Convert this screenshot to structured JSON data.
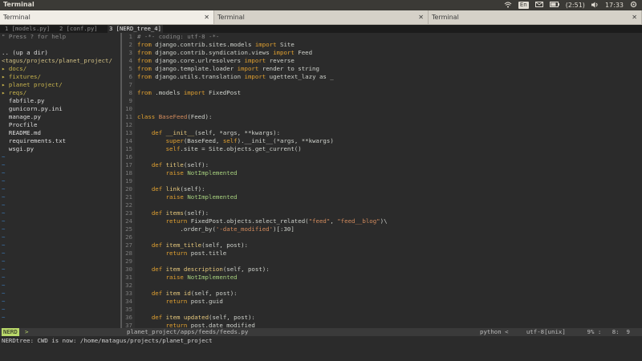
{
  "system": {
    "app_title": "Terminal",
    "battery": "(2:51)",
    "keyboard": "En",
    "clock": "17:33"
  },
  "window_tabs": [
    {
      "label": "Terminal",
      "close": "✕"
    },
    {
      "label": "Terminal",
      "close": "✕"
    },
    {
      "label": "Terminal",
      "close": "✕"
    }
  ],
  "vim_tabs": [
    {
      "label": "1 [models.py]"
    },
    {
      "label": "2 [conf.py]"
    },
    {
      "label": "3 [NERD_tree_4]"
    }
  ],
  "nerdtree": {
    "help": "\" Press ? for help",
    "blank": "",
    "up": ".. (up a dir)",
    "root": "<tagus/projects/planet_project/",
    "entries": [
      {
        "text": "▸ docs/",
        "type": "dir"
      },
      {
        "text": "▸ fixtures/",
        "type": "dir"
      },
      {
        "text": "▸ planet project/",
        "type": "dir"
      },
      {
        "text": "▸ reqs/",
        "type": "dir"
      },
      {
        "text": "  fabfile.py",
        "type": "file"
      },
      {
        "text": "  gunicorn.py.ini",
        "type": "file"
      },
      {
        "text": "  manage.py",
        "type": "file"
      },
      {
        "text": "  Procfile",
        "type": "file"
      },
      {
        "text": "  README.md",
        "type": "file"
      },
      {
        "text": "  requirements.txt",
        "type": "file"
      },
      {
        "text": "  wsgi.py",
        "type": "file"
      }
    ],
    "tilde": "~"
  },
  "code_lines": [
    {
      "n": "1",
      "html": "<span class='cmt'># -*- coding: utf-8 -*-</span>"
    },
    {
      "n": "2",
      "html": "<span class='kw'>from</span> django.contrib.sites.models <span class='kw'>import</span> Site"
    },
    {
      "n": "3",
      "html": "<span class='kw'>from</span> django.contrib.syndication.views <span class='kw'>import</span> Feed"
    },
    {
      "n": "4",
      "html": "<span class='kw'>from</span> django.core.urlresolvers <span class='kw'>import</span> reverse"
    },
    {
      "n": "5",
      "html": "<span class='kw'>from</span> django.template.loader <span class='kw'>import</span> render to string"
    },
    {
      "n": "6",
      "html": "<span class='kw'>from</span> django.utils.translation <span class='kw'>import</span> ugettext_lazy as _"
    },
    {
      "n": "7",
      "html": ""
    },
    {
      "n": "8",
      "html": "<span class='kw'>from</span> .models <span class='kw'>import</span> FixedPost"
    },
    {
      "n": "9",
      "html": ""
    },
    {
      "n": "10",
      "html": ""
    },
    {
      "n": "11",
      "html": "<span class='kw'>class</span> <span class='cls'>BaseFeed</span>(Feed):"
    },
    {
      "n": "12",
      "html": ""
    },
    {
      "n": "13",
      "html": "    <span class='kw'>def</span> <span class='fn'>__init__</span>(self, *args, **kwargs):"
    },
    {
      "n": "14",
      "html": "        <span class='self'>super</span>(BaseFeed, <span class='self'>self</span>).__init__(*args, **kwargs)"
    },
    {
      "n": "15",
      "html": "        <span class='self'>self</span>.site = Site.objects.get_current()"
    },
    {
      "n": "16",
      "html": ""
    },
    {
      "n": "17",
      "html": "    <span class='kw'>def</span> <span class='fn'>title</span>(self):"
    },
    {
      "n": "18",
      "html": "        <span class='kw'>raise</span> <span class='err'>NotImplemented</span>"
    },
    {
      "n": "19",
      "html": ""
    },
    {
      "n": "20",
      "html": "    <span class='kw'>def</span> <span class='fn'>link</span>(self):"
    },
    {
      "n": "21",
      "html": "        <span class='kw'>raise</span> <span class='err'>NotImplemented</span>"
    },
    {
      "n": "22",
      "html": ""
    },
    {
      "n": "23",
      "html": "    <span class='kw'>def</span> <span class='fn'>items</span>(self):"
    },
    {
      "n": "24",
      "html": "        <span class='kw'>return</span> FixedPost.objects.select_related(<span class='str'>\"feed\"</span>, <span class='str'>\"feed__blog\"</span>)\\"
    },
    {
      "n": "25",
      "html": "            .order_by(<span class='str'>'-date_modified'</span>)[:30]"
    },
    {
      "n": "26",
      "html": ""
    },
    {
      "n": "27",
      "html": "    <span class='kw'>def</span> <span class='fn'>item_title</span>(self, post):"
    },
    {
      "n": "28",
      "html": "        <span class='kw'>return</span> post.title"
    },
    {
      "n": "29",
      "html": ""
    },
    {
      "n": "30",
      "html": "    <span class='kw'>def</span> <span class='fn'>item description</span>(self, post):"
    },
    {
      "n": "31",
      "html": "        <span class='kw'>raise</span> <span class='err'>NotImplemented</span>"
    },
    {
      "n": "32",
      "html": ""
    },
    {
      "n": "33",
      "html": "    <span class='kw'>def</span> <span class='fn'>item id</span>(self, post):"
    },
    {
      "n": "34",
      "html": "        <span class='kw'>return</span> post.guid"
    },
    {
      "n": "35",
      "html": ""
    },
    {
      "n": "36",
      "html": "    <span class='kw'>def</span> <span class='fn'>item updated</span>(self, post):"
    },
    {
      "n": "37",
      "html": "        <span class='kw'>return</span> post.date modified"
    }
  ],
  "statusbar": {
    "mode": "NERD",
    "arrow": ">",
    "file": "planet_project/apps/feeds/feeds.py",
    "filetype": "python <",
    "encoding": "utf-8[unix]",
    "percent": "9% :",
    "line": "8:",
    "col": "9"
  },
  "cmdline": "NERDtree: CWD is now: /home/matagus/projects/planet_project",
  "colors": {
    "ubuntu_bar": "#3b3a36",
    "terminal_bg": "#2b2b2b",
    "keyword": "#e0a030",
    "nerd_badge": "#b9d86a"
  }
}
